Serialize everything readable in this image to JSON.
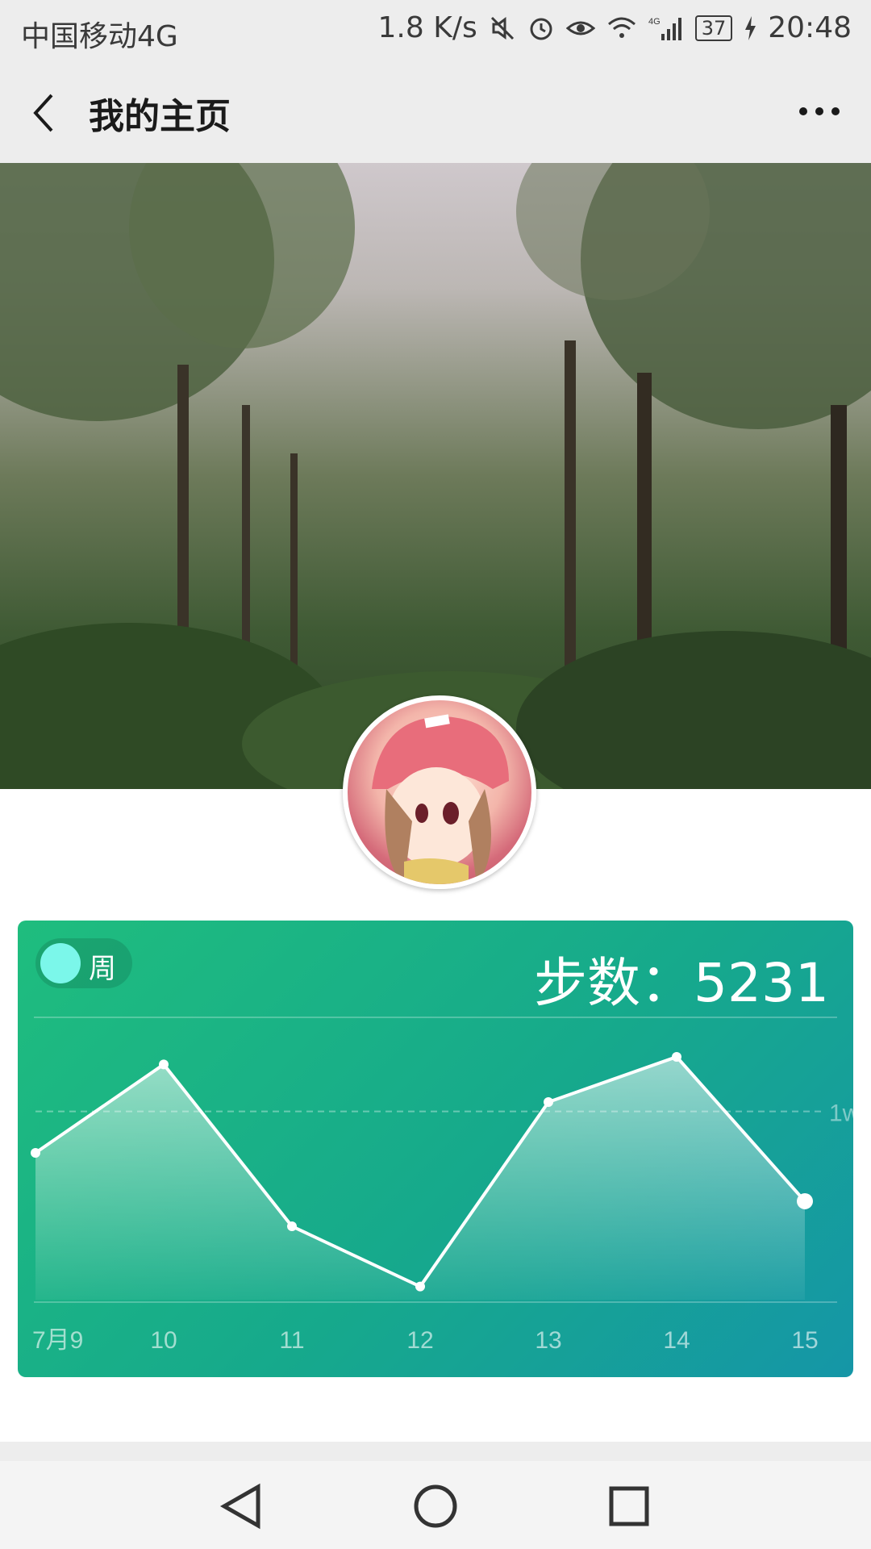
{
  "status_bar": {
    "carrier": "中国移动4G",
    "speed": "1.8 K/s",
    "battery": "37",
    "time": "20:48",
    "icons": [
      "mute-icon",
      "alarm-icon",
      "eye-icon",
      "wifi-icon",
      "signal-icon",
      "charging-icon"
    ]
  },
  "nav": {
    "title": "我的主页"
  },
  "card": {
    "period_label": "周",
    "steps_label": "步数：",
    "steps_value": "5231",
    "ref_label": "1w",
    "accent": "#7bf7ea"
  },
  "chart_data": {
    "type": "area",
    "categories": [
      "7月9",
      "10",
      "11",
      "12",
      "13",
      "14",
      "15"
    ],
    "values": [
      7800,
      12500,
      3900,
      700,
      10500,
      12900,
      5231
    ],
    "reference_lines": [
      {
        "label": "1w",
        "value": 10000
      }
    ],
    "ylim": [
      0,
      15000
    ],
    "grid": false,
    "legend": "none"
  }
}
